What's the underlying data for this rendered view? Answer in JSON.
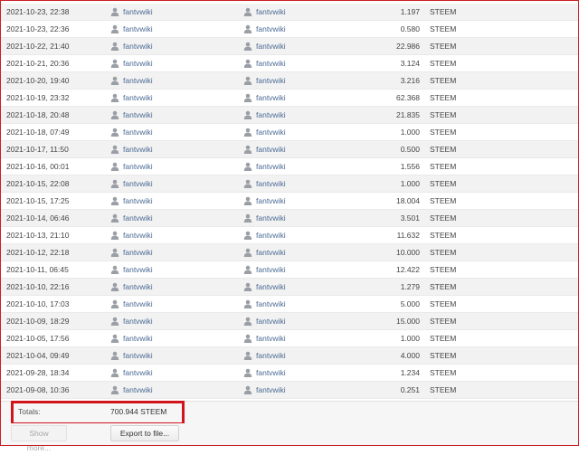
{
  "rows": [
    {
      "date": "2021-10-23, 22:38",
      "from": "fantvwiki",
      "to": "fantvwiki",
      "amount": "1.197",
      "currency": "STEEM"
    },
    {
      "date": "2021-10-23, 22:36",
      "from": "fantvwiki",
      "to": "fantvwiki",
      "amount": "0.580",
      "currency": "STEEM"
    },
    {
      "date": "2021-10-22, 21:40",
      "from": "fantvwiki",
      "to": "fantvwiki",
      "amount": "22.986",
      "currency": "STEEM"
    },
    {
      "date": "2021-10-21, 20:36",
      "from": "fantvwiki",
      "to": "fantvwiki",
      "amount": "3.124",
      "currency": "STEEM"
    },
    {
      "date": "2021-10-20, 19:40",
      "from": "fantvwiki",
      "to": "fantvwiki",
      "amount": "3.216",
      "currency": "STEEM"
    },
    {
      "date": "2021-10-19, 23:32",
      "from": "fantvwiki",
      "to": "fantvwiki",
      "amount": "62.368",
      "currency": "STEEM"
    },
    {
      "date": "2021-10-18, 20:48",
      "from": "fantvwiki",
      "to": "fantvwiki",
      "amount": "21.835",
      "currency": "STEEM"
    },
    {
      "date": "2021-10-18, 07:49",
      "from": "fantvwiki",
      "to": "fantvwiki",
      "amount": "1.000",
      "currency": "STEEM"
    },
    {
      "date": "2021-10-17, 11:50",
      "from": "fantvwiki",
      "to": "fantvwiki",
      "amount": "0.500",
      "currency": "STEEM"
    },
    {
      "date": "2021-10-16, 00:01",
      "from": "fantvwiki",
      "to": "fantvwiki",
      "amount": "1.556",
      "currency": "STEEM"
    },
    {
      "date": "2021-10-15, 22:08",
      "from": "fantvwiki",
      "to": "fantvwiki",
      "amount": "1.000",
      "currency": "STEEM"
    },
    {
      "date": "2021-10-15, 17:25",
      "from": "fantvwiki",
      "to": "fantvwiki",
      "amount": "18.004",
      "currency": "STEEM"
    },
    {
      "date": "2021-10-14, 06:46",
      "from": "fantvwiki",
      "to": "fantvwiki",
      "amount": "3.501",
      "currency": "STEEM"
    },
    {
      "date": "2021-10-13, 21:10",
      "from": "fantvwiki",
      "to": "fantvwiki",
      "amount": "11.632",
      "currency": "STEEM"
    },
    {
      "date": "2021-10-12, 22:18",
      "from": "fantvwiki",
      "to": "fantvwiki",
      "amount": "10.000",
      "currency": "STEEM"
    },
    {
      "date": "2021-10-11, 06:45",
      "from": "fantvwiki",
      "to": "fantvwiki",
      "amount": "12.422",
      "currency": "STEEM"
    },
    {
      "date": "2021-10-10, 22:16",
      "from": "fantvwiki",
      "to": "fantvwiki",
      "amount": "1.279",
      "currency": "STEEM"
    },
    {
      "date": "2021-10-10, 17:03",
      "from": "fantvwiki",
      "to": "fantvwiki",
      "amount": "5.000",
      "currency": "STEEM"
    },
    {
      "date": "2021-10-09, 18:29",
      "from": "fantvwiki",
      "to": "fantvwiki",
      "amount": "15.000",
      "currency": "STEEM"
    },
    {
      "date": "2021-10-05, 17:56",
      "from": "fantvwiki",
      "to": "fantvwiki",
      "amount": "1.000",
      "currency": "STEEM"
    },
    {
      "date": "2021-10-04, 09:49",
      "from": "fantvwiki",
      "to": "fantvwiki",
      "amount": "4.000",
      "currency": "STEEM"
    },
    {
      "date": "2021-09-28, 18:34",
      "from": "fantvwiki",
      "to": "fantvwiki",
      "amount": "1.234",
      "currency": "STEEM"
    },
    {
      "date": "2021-09-08, 10:36",
      "from": "fantvwiki",
      "to": "fantvwiki",
      "amount": "0.251",
      "currency": "STEEM"
    }
  ],
  "totals": {
    "label": "Totals:",
    "value": "700.944 STEEM"
  },
  "footer": {
    "show_more_label": "Show more...",
    "export_label": "Export to file..."
  },
  "icons": {
    "user": "user-icon"
  },
  "colors": {
    "highlight_box": "#d0151d",
    "username_link": "#4a6a94",
    "row_alt": "#f2f2f2"
  }
}
